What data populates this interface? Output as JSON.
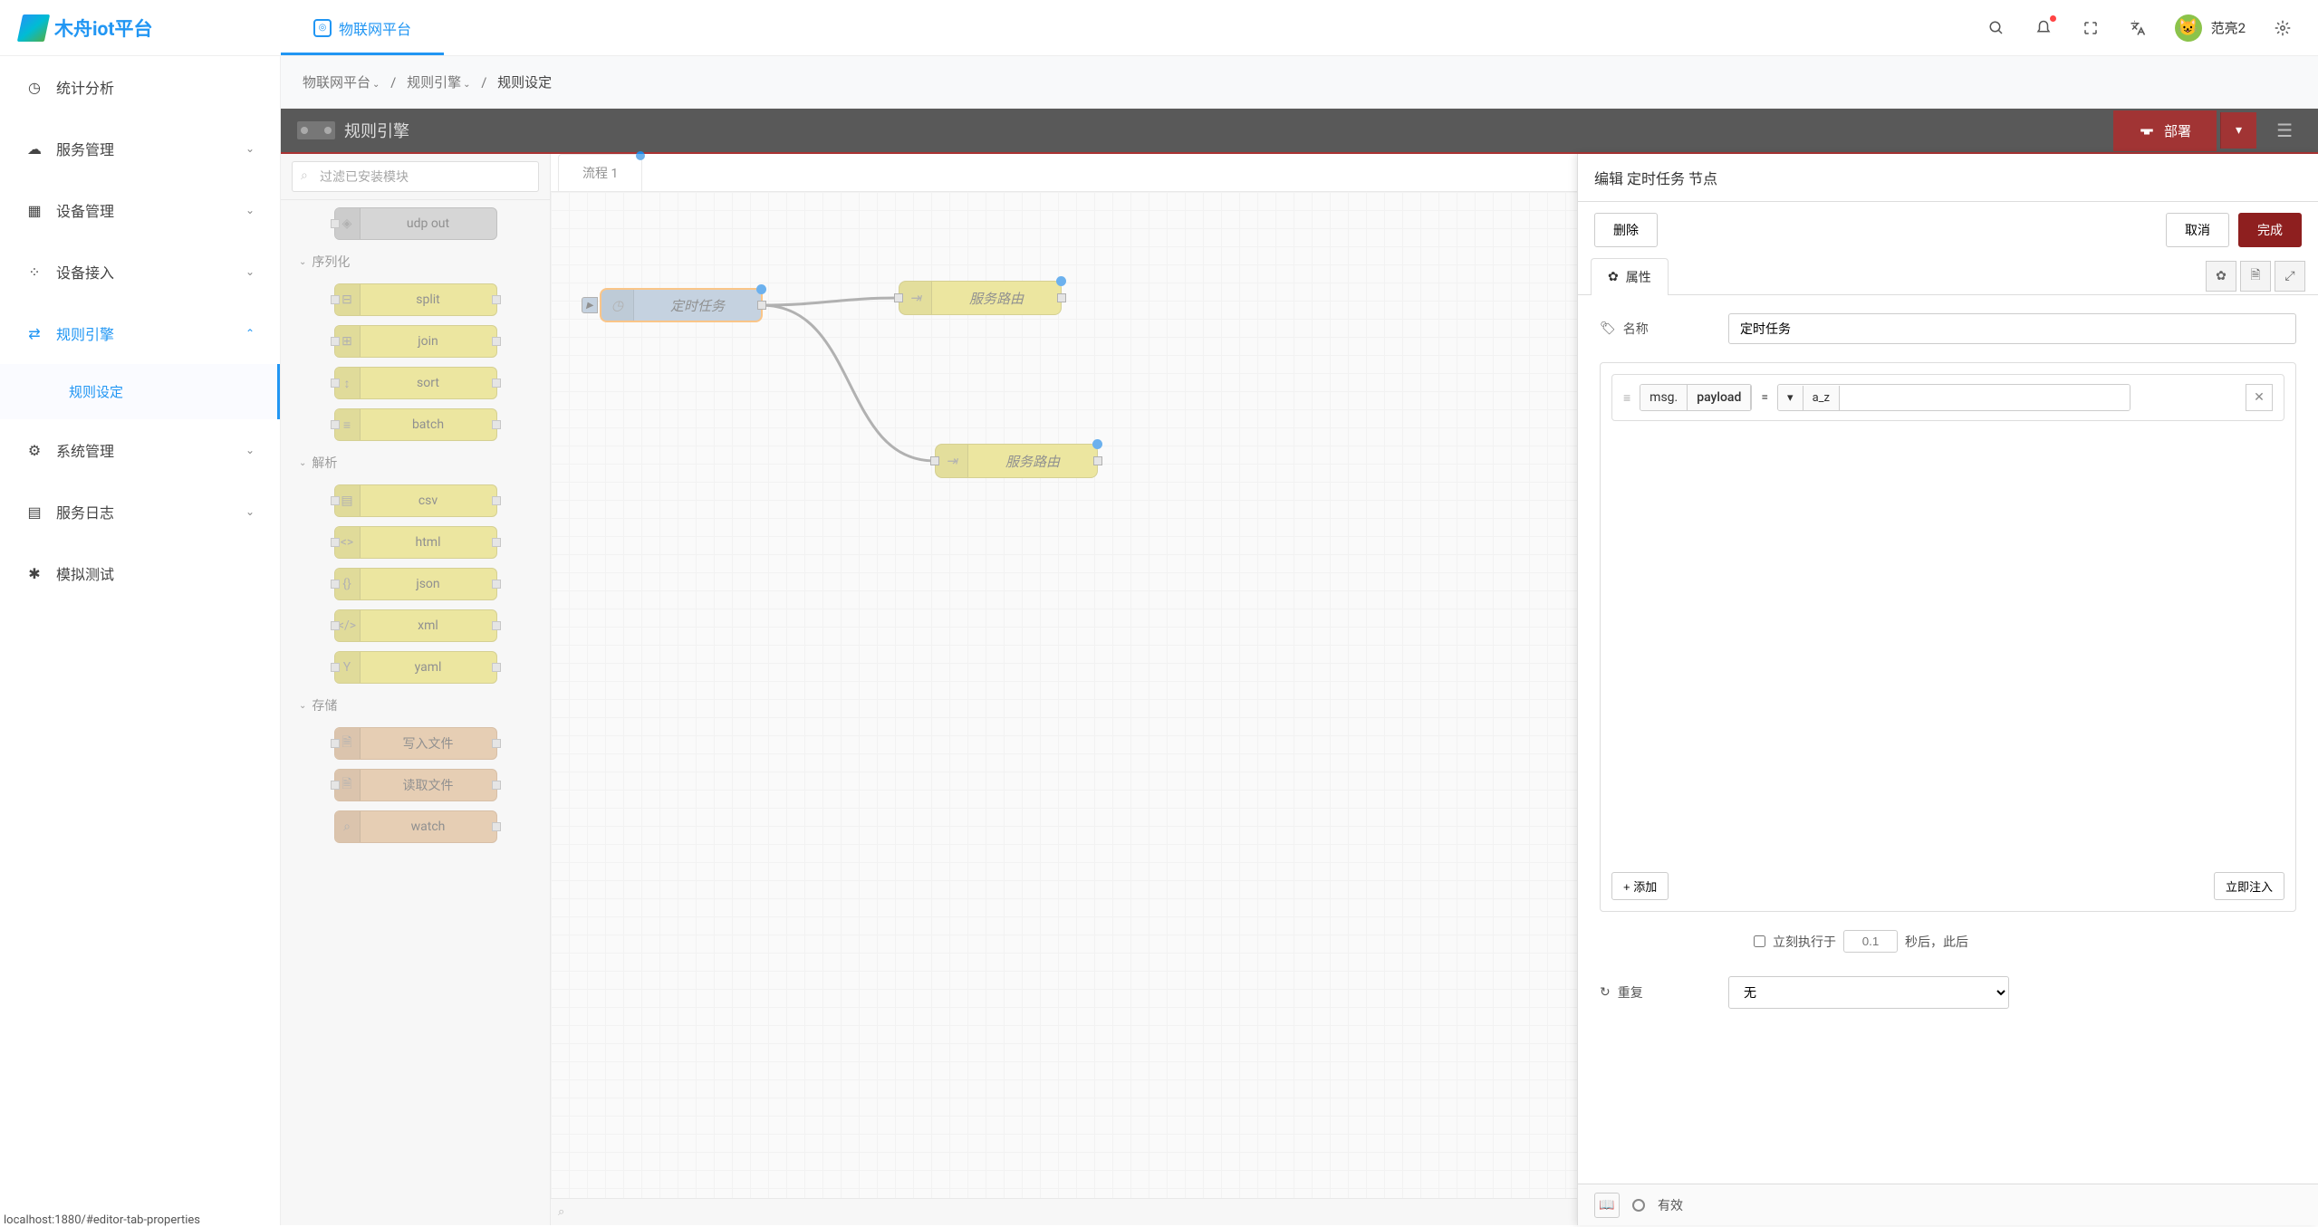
{
  "brand": "木舟iot平台",
  "topTab": "物联网平台",
  "topRight": {
    "username": "范亮2"
  },
  "sidebar": {
    "items": [
      {
        "icon": "clock",
        "label": "统计分析",
        "sub": []
      },
      {
        "icon": "cloud",
        "label": "服务管理",
        "sub": []
      },
      {
        "icon": "device",
        "label": "设备管理",
        "sub": []
      },
      {
        "icon": "link",
        "label": "设备接入",
        "sub": []
      },
      {
        "icon": "flow",
        "label": "规则引擎",
        "active": true,
        "expanded": true,
        "sub": [
          "规则设定"
        ]
      },
      {
        "icon": "gear",
        "label": "系统管理",
        "sub": []
      },
      {
        "icon": "log",
        "label": "服务日志",
        "sub": []
      },
      {
        "icon": "bug",
        "label": "模拟测试",
        "sub": []
      }
    ]
  },
  "breadcrumb": {
    "parts": [
      "物联网平台",
      "规则引擎",
      "规则设定"
    ]
  },
  "editor": {
    "title": "规则引擎",
    "deploy": "部署",
    "palette": {
      "searchPlaceholder": "过滤已安装模块",
      "extraNode": "udp out",
      "cats": [
        {
          "name": "序列化",
          "nodes": [
            "split",
            "join",
            "sort",
            "batch"
          ]
        },
        {
          "name": "解析",
          "nodes": [
            "csv",
            "html",
            "json",
            "xml",
            "yaml"
          ]
        },
        {
          "name": "存储",
          "nodes": [
            "写入文件",
            "读取文件",
            "watch"
          ],
          "storage": true
        }
      ]
    },
    "tabs": [
      {
        "name": "流程 1"
      }
    ],
    "canvasNodes": {
      "inject": "定时任务",
      "route1": "服务路由",
      "route2": "服务路由"
    }
  },
  "editPanel": {
    "title": "编辑 定时任务 节点",
    "actions": {
      "delete": "删除",
      "cancel": "取消",
      "done": "完成"
    },
    "tabs": {
      "props": "属性"
    },
    "fields": {
      "nameLabel": "名称",
      "nameValue": "定时任务",
      "msgPrefix": "msg.",
      "msgField": "payload",
      "equals": "=",
      "typeHint": "a_z",
      "addBtn": "+ 添加",
      "injectNow": "立即注入",
      "inlineCheck": "立刻执行于",
      "inlineVal": "0.1",
      "inlineSuffix": "秒后，此后",
      "repeatLabel": "重复",
      "repeatValue": "无"
    },
    "footer": {
      "valid": "有效"
    }
  },
  "statusBar": "localhost:1880/#editor-tab-properties"
}
